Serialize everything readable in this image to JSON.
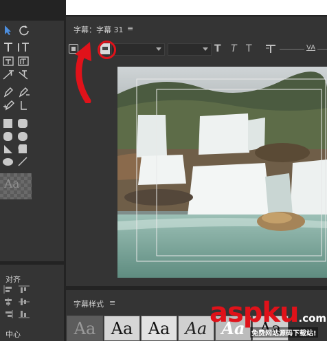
{
  "colors": {
    "app_bg": "#232323",
    "panel_bg": "#343434",
    "accent_blue": "#4d8fe0",
    "annotation_red": "#e0121a"
  },
  "title_panel": {
    "title": "字幕：字幕 31",
    "menu_icon": "≡"
  },
  "tools_panel": {
    "preview_glyph": "Aa"
  },
  "align_panel": {
    "title": "对齐",
    "center_label": "中心"
  },
  "styles_panel": {
    "title": "字幕样式",
    "menu_icon": "≡",
    "swatches": [
      "Aa",
      "Aa",
      "Aa",
      "Aa",
      "Aa",
      "Aa"
    ]
  },
  "toolbar": {
    "icons": [
      "roll-crawl-icon",
      "templates-icon"
    ],
    "text_style_glyphs": [
      "T",
      "T",
      "T"
    ],
    "tracking_label": "VA"
  },
  "watermark": {
    "brand": "aspku",
    "tld": ".com",
    "tagline": "免费网站源码下载站!"
  }
}
